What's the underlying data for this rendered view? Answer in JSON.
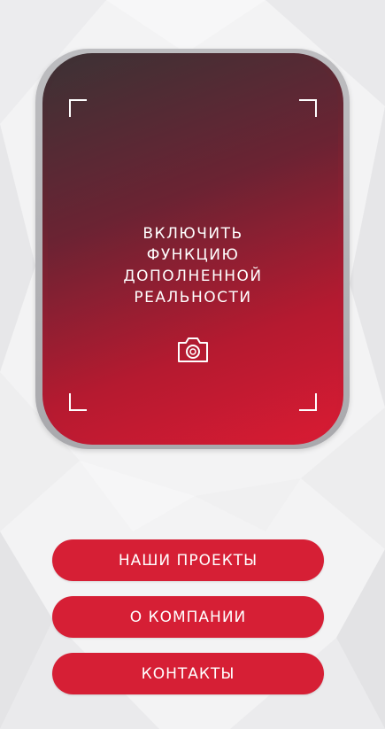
{
  "ar_card": {
    "label_lines": [
      "ВКЛЮЧИТЬ",
      "ФУНКЦИЮ",
      "ДОПОЛНЕННОЙ",
      "РЕАЛЬНОСТИ"
    ],
    "icon": "camera-icon"
  },
  "buttons": {
    "projects": "НАШИ ПРОЕКТЫ",
    "about": "О КОМПАНИИ",
    "contacts": "КОНТАКТЫ"
  },
  "colors": {
    "accent": "#d61f35",
    "card_dark": "#3b3134",
    "background": "#f4f4f5"
  }
}
